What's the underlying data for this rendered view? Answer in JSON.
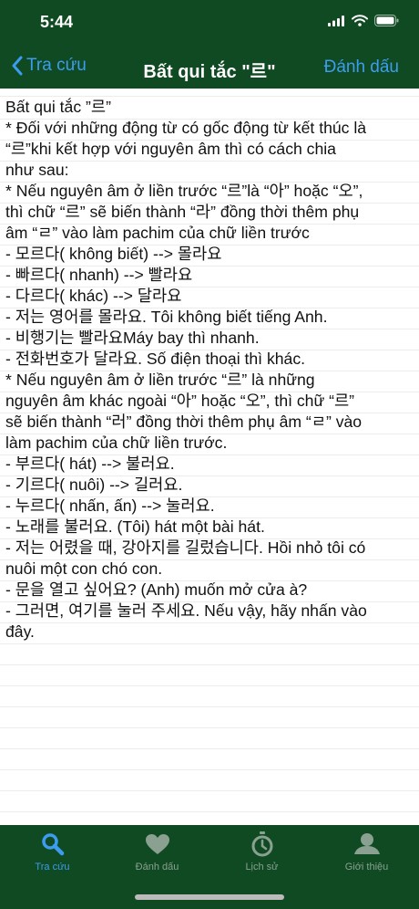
{
  "status_bar": {
    "time": "5:44"
  },
  "nav": {
    "back_label": "Tra cứu",
    "title": "Bất qui tắc \"르\"",
    "bookmark_label": "Đánh dấu"
  },
  "content": {
    "lines": [
      "Bất qui tắc ”르”",
      "* Đối với những động từ có gốc động từ kết thúc là",
      "“르”khi kết hợp với nguyên âm thì có cách chia",
      "như sau:",
      "* Nếu nguyên âm ở liền trước “르”là “아” hoặc “오”,",
      "thì chữ “르” sẽ biến thành “라” đồng thời thêm phụ",
      "âm “ㄹ” vào làm pachim của chữ liền trước",
      "-  모르다( không biết) --> 몰라요",
      "-  빠르다( nhanh) --> 빨라요",
      "-  다르다( khác) --> 달라요",
      "-  저는 영어를 몰라요. Tôi không biết tiếng Anh.",
      "-  비행기는 빨라요Máy bay thì nhanh.",
      "-  전화번호가 달라요. Số điện thoại thì khác.",
      "* Nếu nguyên âm ở liền trước “르” là những",
      "nguyên âm khác ngoài “아” hoặc “오”, thì chữ “르”",
      "sẽ biến thành “러” đồng thời thêm phụ âm “ㄹ” vào",
      "làm pachim của chữ liền trước.",
      "-  부르다( hát) --> 불러요.",
      "-  기르다( nuôi) --> 길러요.",
      "-  누르다( nhấn, ấn) --> 눌러요.",
      "-  노래를 불러요. (Tôi) hát một bài hát.",
      "-  저는 어렸을 때, 강아지를 길렀습니다. Hồi nhỏ tôi có",
      "nuôi một con chó con.",
      "-  문을 열고 싶어요? (Anh) muốn mở cửa à?",
      "-  그러면, 여기를 눌러 주세요. Nếu vậy, hãy nhấn vào",
      "đây."
    ]
  },
  "tabbar": {
    "tabs": [
      {
        "label": "Tra cứu",
        "icon": "search-icon",
        "active": true
      },
      {
        "label": "Đánh dấu",
        "icon": "heart-icon",
        "active": false
      },
      {
        "label": "Lịch sử",
        "icon": "stopwatch-icon",
        "active": false
      },
      {
        "label": "Giới thiệu",
        "icon": "person-icon",
        "active": false
      }
    ]
  },
  "colors": {
    "brand_green": "#0f4a22",
    "accent_blue": "#3d9cf0",
    "inactive_tab": "#8aa091"
  }
}
